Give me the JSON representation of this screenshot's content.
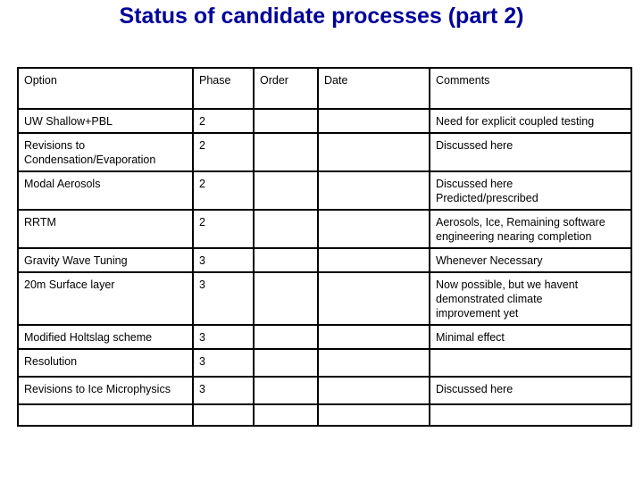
{
  "slide": {
    "title": "Status of candidate processes (part 2)",
    "title_color": "#000099",
    "background_color": "#FFFFFF",
    "border_color": "#000000"
  },
  "table": {
    "columns": [
      "Option",
      "Phase",
      "Order",
      "Date",
      "Comments"
    ],
    "rows": [
      {
        "option": "UW Shallow+PBL",
        "phase": "2",
        "order": "",
        "date": "",
        "comments": [
          "Need for explicit coupled testing"
        ]
      },
      {
        "option": "Revisions to Condensation/Evaporation",
        "option_lines": [
          "Revisions to",
          "Condensation/Evaporation"
        ],
        "phase": "2",
        "order": "",
        "date": "",
        "comments": [
          "Discussed here"
        ]
      },
      {
        "option": "Modal Aerosols",
        "phase": "2",
        "order": "",
        "date": "",
        "comments": [
          "Discussed here",
          "Predicted/prescribed"
        ]
      },
      {
        "option": "RRTM",
        "phase": "2",
        "order": "",
        "date": "",
        "comments": [
          "Aerosols, Ice, Remaining software",
          "engineering nearing completion"
        ]
      },
      {
        "option": "Gravity Wave Tuning",
        "phase": "3",
        "order": "",
        "date": "",
        "comments": [
          "Whenever Necessary"
        ]
      },
      {
        "option": "20m Surface layer",
        "phase": "3",
        "order": "",
        "date": "",
        "comments": [
          "Now possible, but we havent",
          "demonstrated climate",
          "improvement yet"
        ]
      },
      {
        "option": "Modified Holtslag scheme",
        "phase": "3",
        "order": "",
        "date": "",
        "comments": [
          "Minimal effect"
        ]
      },
      {
        "option": "Resolution",
        "phase": "3",
        "order": "",
        "date": "",
        "comments": [
          ""
        ]
      },
      {
        "option": "Revisions to Ice Microphysics",
        "phase": "3",
        "order": "",
        "date": "",
        "comments": [
          "Discussed here"
        ]
      },
      {
        "option": "",
        "phase": "",
        "order": "",
        "date": "",
        "comments": [
          ""
        ]
      }
    ]
  }
}
